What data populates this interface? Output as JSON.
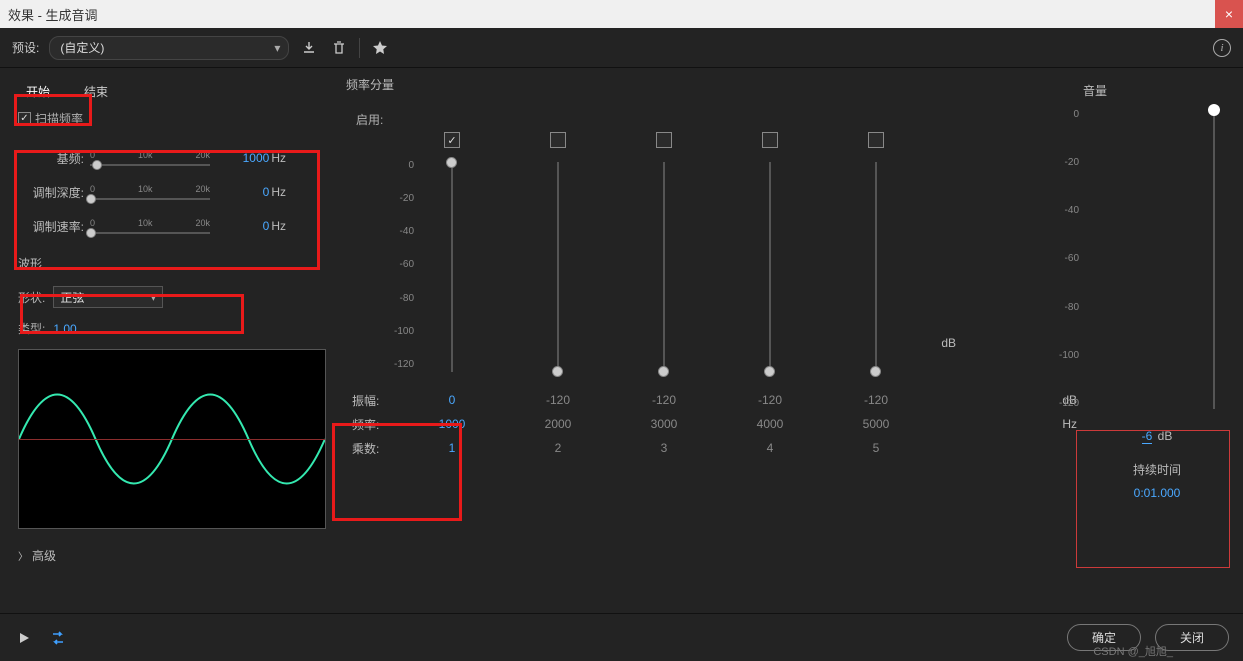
{
  "window": {
    "title": "效果 - 生成音调"
  },
  "preset": {
    "label": "预设:",
    "value": "(自定义)"
  },
  "tabs": {
    "start": "开始",
    "end": "结束"
  },
  "sweep": {
    "label": "扫描频率",
    "checked": true
  },
  "sliders": {
    "base": {
      "label": "基频:",
      "value": "1000",
      "unit": "Hz"
    },
    "depth": {
      "label": "调制深度:",
      "value": "0",
      "unit": "Hz"
    },
    "rate": {
      "label": "调制速率:",
      "value": "0",
      "unit": "Hz"
    },
    "ticks": [
      "0",
      "10k",
      "20k"
    ]
  },
  "waveform": {
    "section": "波形",
    "shape_label": "形状:",
    "shape_value": "正弦",
    "type_label": "类型:",
    "type_value": "1.00"
  },
  "freq": {
    "title": "频率分量",
    "enable": "启用:",
    "amp_label": "振幅:",
    "hz_label": "频率:",
    "mult_label": "乘数:",
    "db_unit": "dB",
    "hz_unit": "Hz",
    "vticks": [
      "0",
      "-20",
      "-40",
      "-60",
      "-80",
      "-100",
      "-120"
    ],
    "cols": [
      {
        "checked": true,
        "amp": "0",
        "hz": "1000",
        "mult": "1"
      },
      {
        "checked": false,
        "amp": "-120",
        "hz": "2000",
        "mult": "2"
      },
      {
        "checked": false,
        "amp": "-120",
        "hz": "3000",
        "mult": "3"
      },
      {
        "checked": false,
        "amp": "-120",
        "hz": "4000",
        "mult": "4"
      },
      {
        "checked": false,
        "amp": "-120",
        "hz": "5000",
        "mult": "5"
      }
    ]
  },
  "volume": {
    "label": "音量",
    "ticks": [
      "0",
      "-20",
      "-40",
      "-60",
      "-80",
      "-100",
      "-120"
    ],
    "value": "-6",
    "unit": "dB"
  },
  "duration": {
    "label": "持续时间",
    "value": "0:01.000"
  },
  "advanced": "高级",
  "buttons": {
    "ok": "确定",
    "close": "关闭"
  },
  "watermark": "CSDN @_旭旭_"
}
